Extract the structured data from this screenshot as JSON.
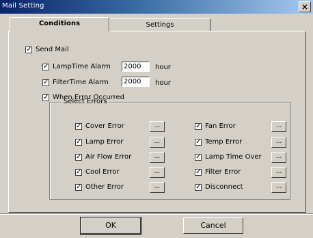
{
  "window": {
    "title": "Mail Setting",
    "close_glyph": "×"
  },
  "tabs": [
    {
      "label": "Conditions",
      "active": true
    },
    {
      "label": "Settings",
      "active": false
    }
  ],
  "send_mail": {
    "label": "Send Mail",
    "checked": true
  },
  "lamp_alarm": {
    "label": "LampTime Alarm",
    "value": "2000",
    "unit": "hour",
    "checked": true
  },
  "filter_alarm": {
    "label": "FilterTime Alarm",
    "value": "2000",
    "unit": "hour",
    "checked": true
  },
  "when_error": {
    "label": "When Error Occurred",
    "checked": true
  },
  "select_errors": {
    "title": "Select Errors",
    "left": [
      {
        "label": "Cover Error",
        "checked": true
      },
      {
        "label": "Lamp Error",
        "checked": true
      },
      {
        "label": "Air Flow Error",
        "checked": true
      },
      {
        "label": "Cool Error",
        "checked": true
      },
      {
        "label": "Other Error",
        "checked": true
      }
    ],
    "right": [
      {
        "label": "Fan Error",
        "checked": true
      },
      {
        "label": "Temp Error",
        "checked": true
      },
      {
        "label": "Lamp Time Over",
        "checked": true
      },
      {
        "label": "Filter Error",
        "checked": true
      },
      {
        "label": "Disconnect",
        "checked": true
      }
    ],
    "dots_label": "..."
  },
  "check_glyph": "✓",
  "buttons": {
    "ok": "OK",
    "cancel": "Cancel"
  }
}
